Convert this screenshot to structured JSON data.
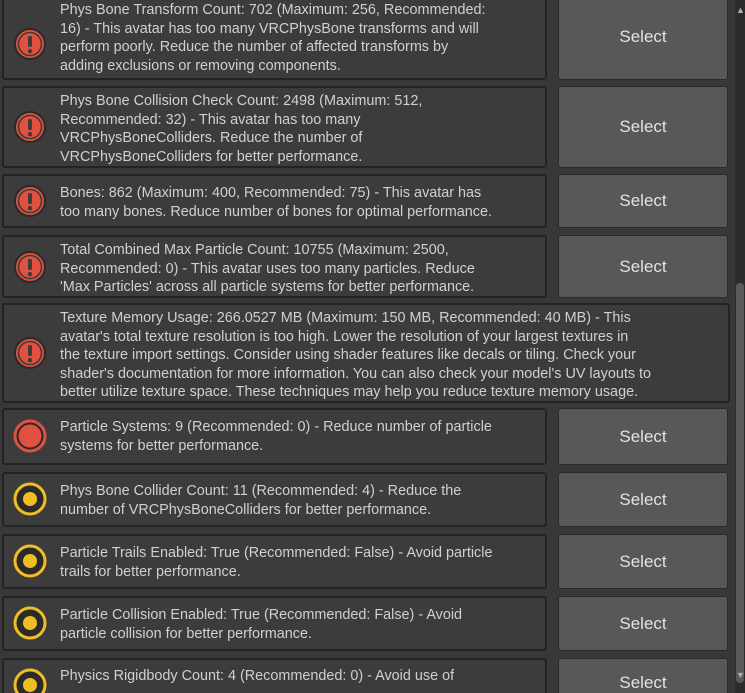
{
  "colors": {
    "error": "#e2513f",
    "warning": "#f0bd24",
    "row_background": "#3c3c3c",
    "button_background": "#585858",
    "text": "#d0d0d0"
  },
  "messages": [
    {
      "severity": "error-exclamation",
      "lines": [
        "Phys Bone Transform Count: 702 (Maximum: 256, Recommended:",
        "16) - This avatar has too many VRCPhysBone transforms and will",
        "perform poorly. Reduce the number of affected transforms by",
        "adding exclusions or removing components."
      ],
      "button_label": "Select"
    },
    {
      "severity": "error-exclamation",
      "lines": [
        "Phys Bone Collision Check Count: 2498 (Maximum: 512,",
        "Recommended: 32) - This avatar has too many",
        "VRCPhysBoneColliders. Reduce the number of",
        "VRCPhysBoneColliders for better performance."
      ],
      "button_label": "Select"
    },
    {
      "severity": "error-exclamation",
      "lines": [
        "Bones: 862 (Maximum: 400, Recommended: 75) - This avatar has",
        "too many bones. Reduce number of bones for optimal performance."
      ],
      "button_label": "Select"
    },
    {
      "severity": "error-exclamation",
      "lines": [
        "Total Combined Max Particle Count: 10755 (Maximum: 2500,",
        "Recommended: 0) - This avatar uses too many particles. Reduce",
        "'Max Particles' across all particle systems for better performance."
      ],
      "button_label": "Select"
    },
    {
      "severity": "error-exclamation",
      "lines": [
        "Texture Memory Usage: 266.0527 MB (Maximum: 150 MB, Recommended: 40 MB) - This",
        "avatar's total texture resolution is too high. Lower the resolution of your largest textures in",
        "the texture import settings. Consider using shader features like decals or tiling. Check your",
        "shader's documentation for more information. You can also check your model's UV layouts to",
        "better utilize texture space. These techniques may help you reduce texture memory usage."
      ],
      "button_label": ""
    },
    {
      "severity": "error-dot",
      "lines": [
        "Particle Systems: 9 (Recommended: 0) - Reduce number of particle",
        "systems for better performance."
      ],
      "button_label": "Select"
    },
    {
      "severity": "warning-dot",
      "lines": [
        "Phys Bone Collider Count: 11 (Recommended: 4) - Reduce the",
        "number of VRCPhysBoneColliders for better performance."
      ],
      "button_label": "Select"
    },
    {
      "severity": "warning-dot",
      "lines": [
        "Particle Trails Enabled: True (Recommended: False) - Avoid particle",
        "trails for better performance."
      ],
      "button_label": "Select"
    },
    {
      "severity": "warning-dot",
      "lines": [
        "Particle Collision Enabled: True (Recommended: False) - Avoid",
        "particle collision for better performance."
      ],
      "button_label": "Select"
    },
    {
      "severity": "warning-dot",
      "lines": [
        "Physics Rigidbody Count: 4 (Recommended: 0) - Avoid use of"
      ],
      "button_label": "Select"
    }
  ]
}
